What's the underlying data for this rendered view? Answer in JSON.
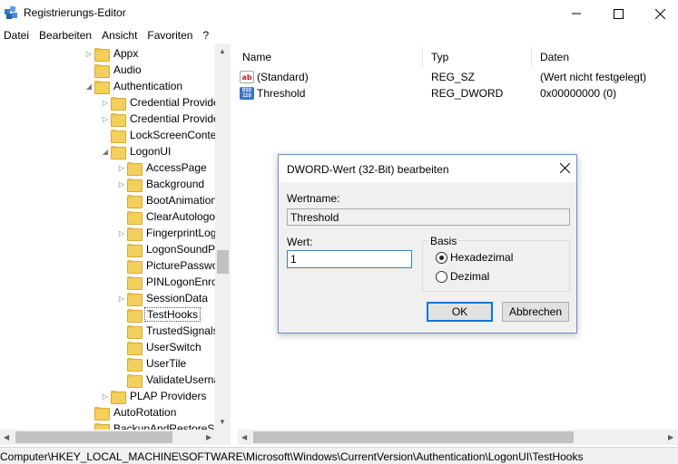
{
  "window": {
    "title": "Registrierungs-Editor",
    "icon": "regedit-icon"
  },
  "menu": [
    "Datei",
    "Bearbeiten",
    "Ansicht",
    "Favoriten",
    "?"
  ],
  "tree": [
    {
      "label": "Appx",
      "expander": "collapsed"
    },
    {
      "label": "Audio",
      "expander": "none"
    },
    {
      "label": "Authentication",
      "expander": "expanded"
    },
    {
      "label": "Credential Provide",
      "expander": "collapsed"
    },
    {
      "label": "Credential Provide",
      "expander": "collapsed"
    },
    {
      "label": "LockScreenConter",
      "expander": "none"
    },
    {
      "label": "LogonUI",
      "expander": "expanded"
    },
    {
      "label": "AccessPage",
      "expander": "collapsed"
    },
    {
      "label": "Background",
      "expander": "collapsed"
    },
    {
      "label": "BootAnimation",
      "expander": "none"
    },
    {
      "label": "ClearAutologo",
      "expander": "none"
    },
    {
      "label": "FingerprintLog",
      "expander": "collapsed"
    },
    {
      "label": "LogonSoundP",
      "expander": "none"
    },
    {
      "label": "PicturePasswo",
      "expander": "none"
    },
    {
      "label": "PINLogonEnro",
      "expander": "none"
    },
    {
      "label": "SessionData",
      "expander": "collapsed"
    },
    {
      "label": "TestHooks",
      "expander": "none",
      "selected": true
    },
    {
      "label": "TrustedSignals",
      "expander": "none"
    },
    {
      "label": "UserSwitch",
      "expander": "none"
    },
    {
      "label": "UserTile",
      "expander": "none"
    },
    {
      "label": "ValidateUserna",
      "expander": "none"
    },
    {
      "label": "PLAP Providers",
      "expander": "collapsed"
    },
    {
      "label": "AutoRotation",
      "expander": "none"
    },
    {
      "label": "BackupAndRestoreSe",
      "expander": "none"
    }
  ],
  "list": {
    "columns": [
      "Name",
      "Typ",
      "Daten"
    ],
    "rows": [
      {
        "name": "(Standard)",
        "type": "REG_SZ",
        "data": "(Wert nicht festgelegt)",
        "icon": "string-value-icon"
      },
      {
        "name": "Threshold",
        "type": "REG_DWORD",
        "data": "0x00000000 (0)",
        "icon": "dword-value-icon"
      }
    ]
  },
  "status": {
    "path": "Computer\\HKEY_LOCAL_MACHINE\\SOFTWARE\\Microsoft\\Windows\\CurrentVersion\\Authentication\\LogonUI\\TestHooks"
  },
  "dialog": {
    "title": "DWORD-Wert (32-Bit) bearbeiten",
    "name_label": "Wertname:",
    "name_value": "Threshold",
    "value_label": "Wert:",
    "value": "1",
    "base_label": "Basis",
    "radio_hex": "Hexadezimal",
    "radio_dec": "Dezimal",
    "ok": "OK",
    "cancel": "Abbrechen"
  },
  "colors": {
    "folder": "#f3d05c",
    "accent": "#0078d7"
  }
}
